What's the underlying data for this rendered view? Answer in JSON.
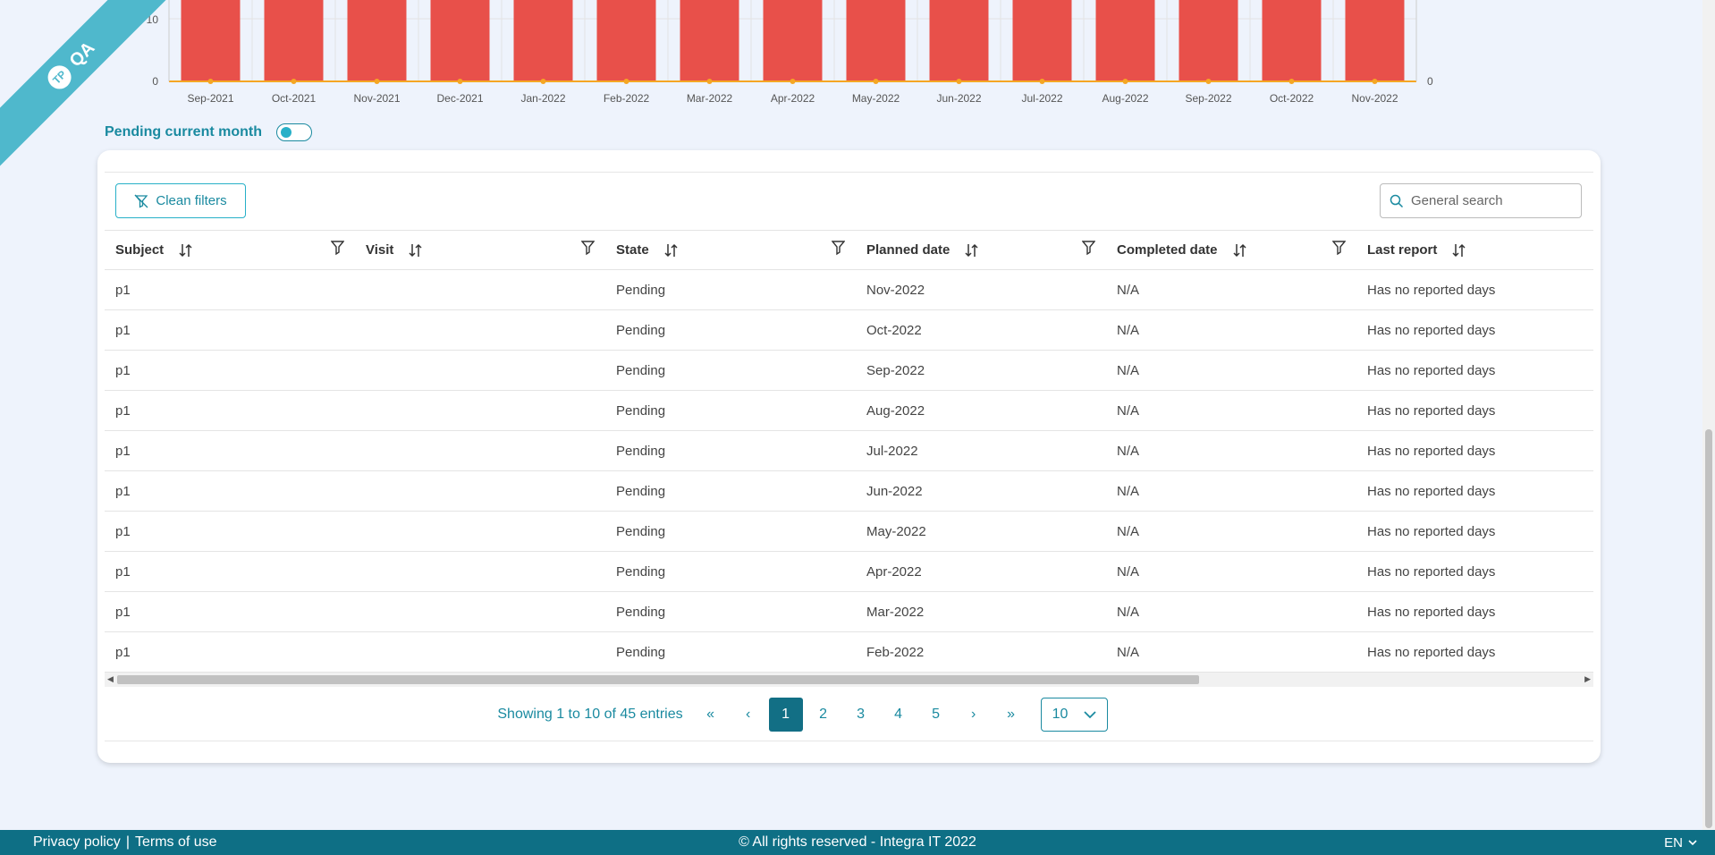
{
  "ribbon": {
    "text": "QA",
    "badge": "TP"
  },
  "chart_data": {
    "type": "bar",
    "categories": [
      "Sep-2021",
      "Oct-2021",
      "Nov-2021",
      "Dec-2021",
      "Jan-2022",
      "Feb-2022",
      "Mar-2022",
      "Apr-2022",
      "May-2022",
      "Jun-2022",
      "Jul-2022",
      "Aug-2022",
      "Sep-2022",
      "Oct-2022",
      "Nov-2022"
    ],
    "y_ticks_left": [
      "0",
      "10"
    ],
    "y_ticks_right": [
      "0"
    ],
    "series": [
      {
        "values": [],
        "type": "bar",
        "color": "#e8504a"
      },
      {
        "values": [
          0,
          0,
          0,
          0,
          0,
          0,
          0,
          0,
          0,
          0,
          0,
          0,
          0,
          0,
          0
        ],
        "type": "line",
        "color": "#f5a623"
      }
    ]
  },
  "toggle": {
    "label": "Pending current month",
    "checked": false
  },
  "toolbar": {
    "clean_filters_label": "Clean filters",
    "search_placeholder": "General search"
  },
  "table": {
    "columns": [
      {
        "label": "Subject"
      },
      {
        "label": "Visit"
      },
      {
        "label": "State"
      },
      {
        "label": "Planned date"
      },
      {
        "label": "Completed date"
      },
      {
        "label": "Last report"
      }
    ],
    "rows": [
      [
        "p1",
        "",
        "Pending",
        "Nov-2022",
        "N/A",
        "Has no reported days"
      ],
      [
        "p1",
        "",
        "Pending",
        "Oct-2022",
        "N/A",
        "Has no reported days"
      ],
      [
        "p1",
        "",
        "Pending",
        "Sep-2022",
        "N/A",
        "Has no reported days"
      ],
      [
        "p1",
        "",
        "Pending",
        "Aug-2022",
        "N/A",
        "Has no reported days"
      ],
      [
        "p1",
        "",
        "Pending",
        "Jul-2022",
        "N/A",
        "Has no reported days"
      ],
      [
        "p1",
        "",
        "Pending",
        "Jun-2022",
        "N/A",
        "Has no reported days"
      ],
      [
        "p1",
        "",
        "Pending",
        "May-2022",
        "N/A",
        "Has no reported days"
      ],
      [
        "p1",
        "",
        "Pending",
        "Apr-2022",
        "N/A",
        "Has no reported days"
      ],
      [
        "p1",
        "",
        "Pending",
        "Mar-2022",
        "N/A",
        "Has no reported days"
      ],
      [
        "p1",
        "",
        "Pending",
        "Feb-2022",
        "N/A",
        "Has no reported days"
      ]
    ]
  },
  "pagination": {
    "showing": "Showing 1 to 10 of 45 entries",
    "pages": [
      "1",
      "2",
      "3",
      "4",
      "5"
    ],
    "active_page": "1",
    "first": "«",
    "prev": "‹",
    "next": "›",
    "last": "»",
    "per_page": "10"
  },
  "footer": {
    "privacy": "Privacy policy",
    "separator": "|",
    "terms": "Terms of use",
    "copyright": "© All rights reserved - Integra IT 2022",
    "language": "EN"
  },
  "colors": {
    "accent": "#1a8aa0",
    "footer_bg": "#0e6f85",
    "bar": "#e8504a",
    "line": "#f5a623"
  }
}
